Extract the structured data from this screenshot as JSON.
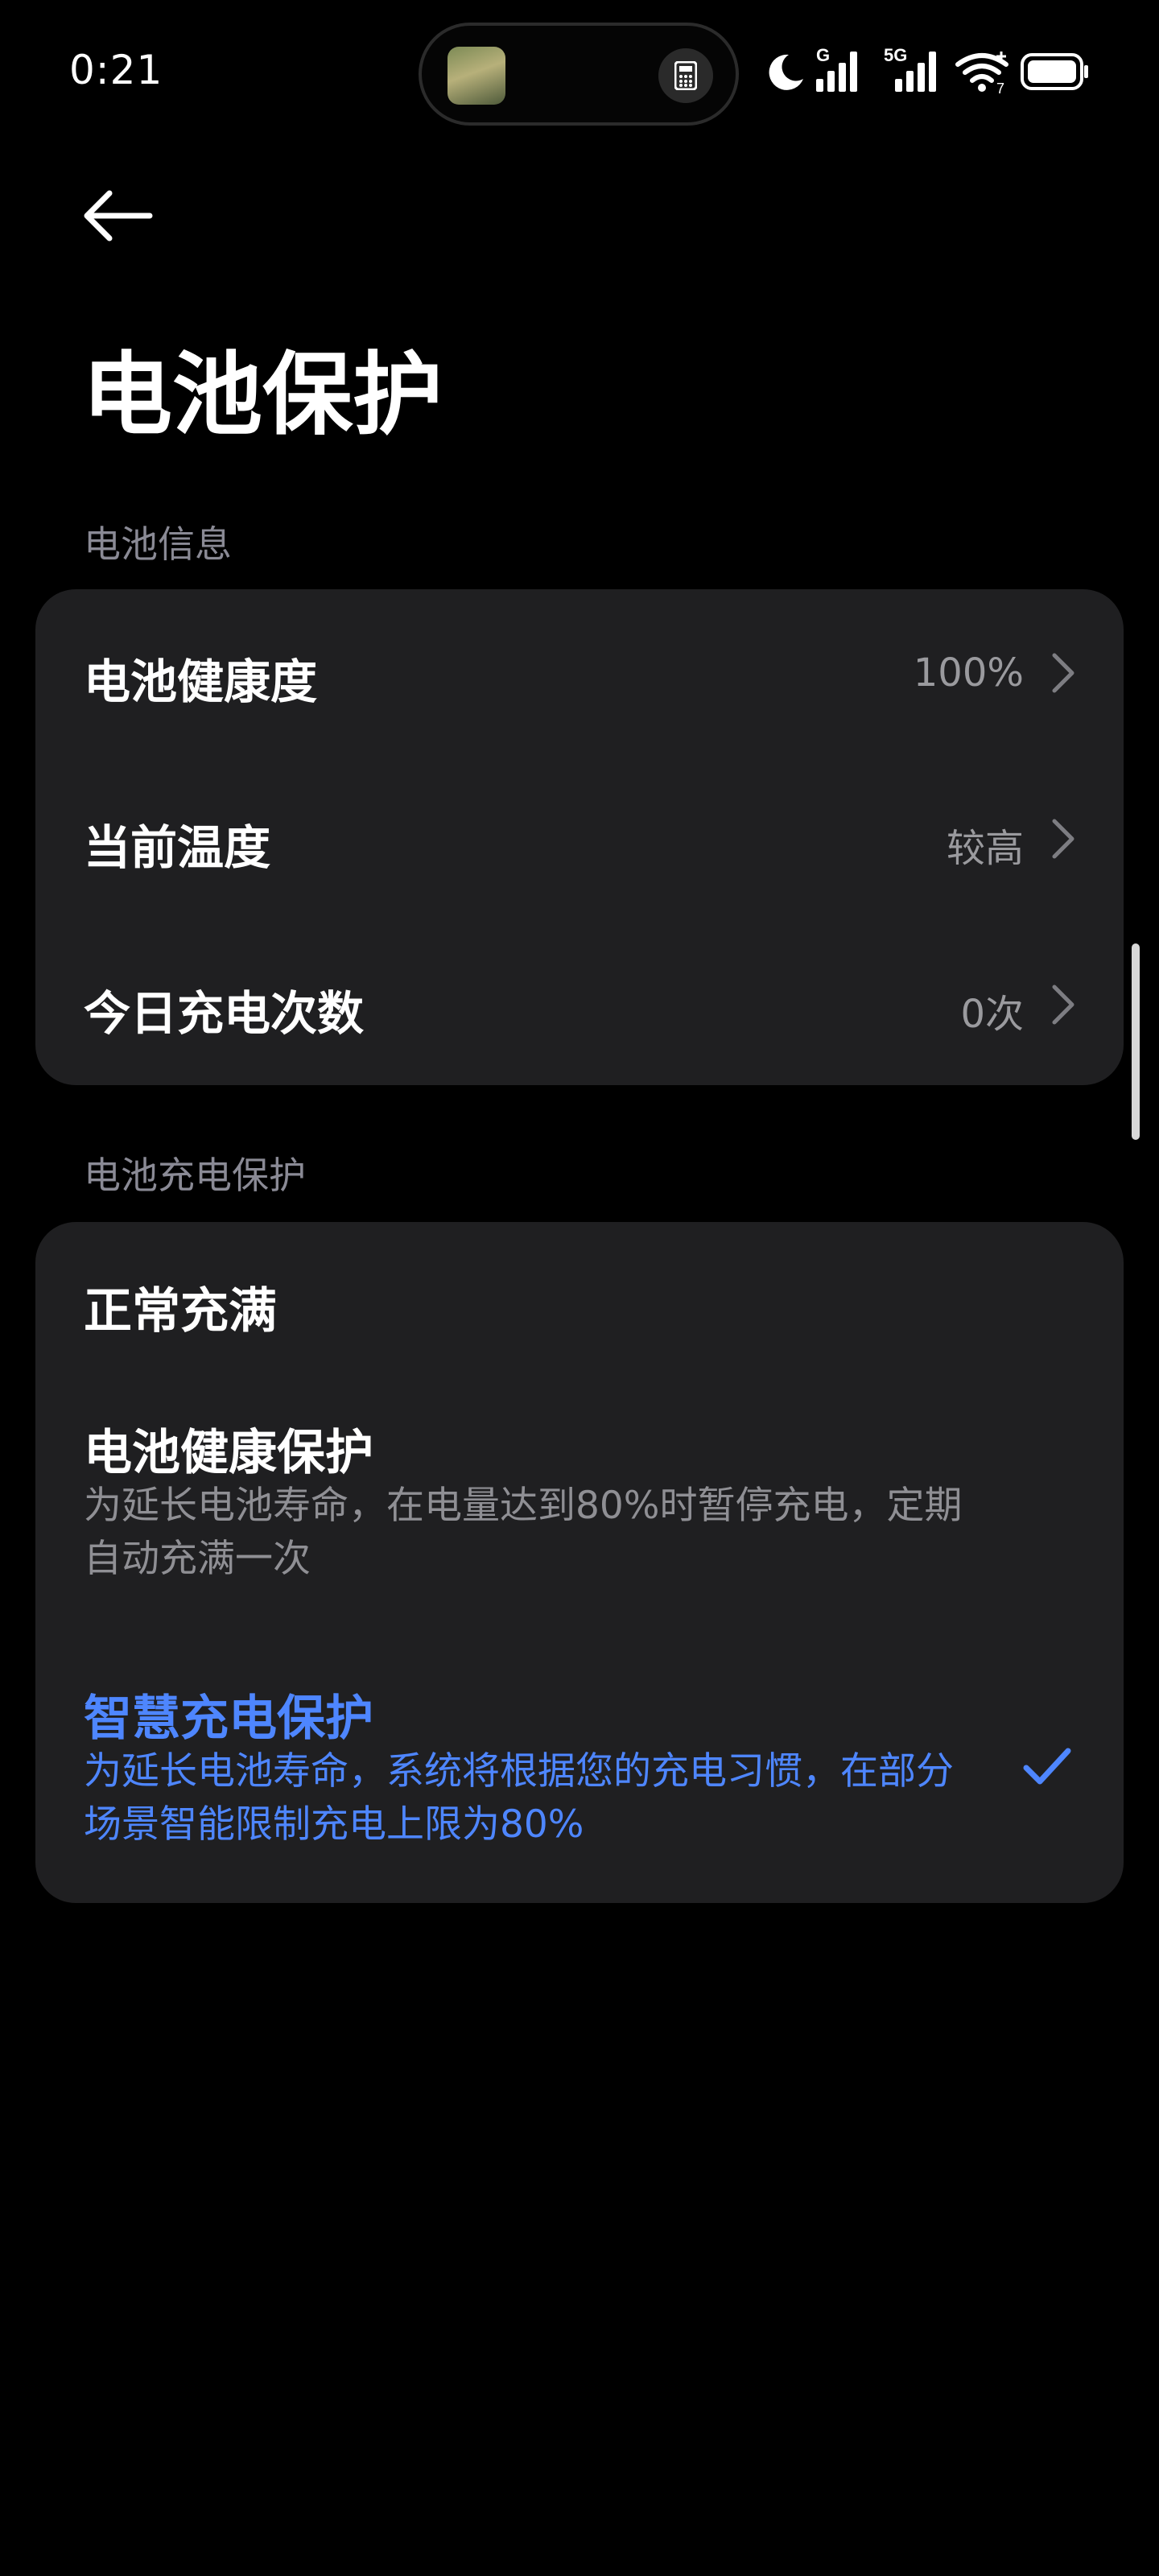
{
  "status_bar": {
    "time": "0:21",
    "signal1_label": "G",
    "signal2_label": "5G",
    "wifi_label": "7"
  },
  "header": {
    "title": "电池保护"
  },
  "battery_info": {
    "header": "电池信息",
    "rows": [
      {
        "label": "电池健康度",
        "value": "100%"
      },
      {
        "label": "当前温度",
        "value": "较高"
      },
      {
        "label": "今日充电次数",
        "value": "0次"
      }
    ]
  },
  "charge_protection": {
    "header": "电池充电保护",
    "options": [
      {
        "title": "正常充满",
        "desc": "",
        "selected": false
      },
      {
        "title": "电池健康保护",
        "desc": "为延长电池寿命，在电量达到80%时暂停充电，定期自动充满一次",
        "selected": false
      },
      {
        "title": "智慧充电保护",
        "desc": "为延长电池寿命，系统将根据您的充电习惯，在部分场景智能限制充电上限为80%",
        "selected": true
      }
    ]
  },
  "colors": {
    "accent": "#4e86ff",
    "card_bg": "#1f1f21",
    "background": "#000000"
  }
}
